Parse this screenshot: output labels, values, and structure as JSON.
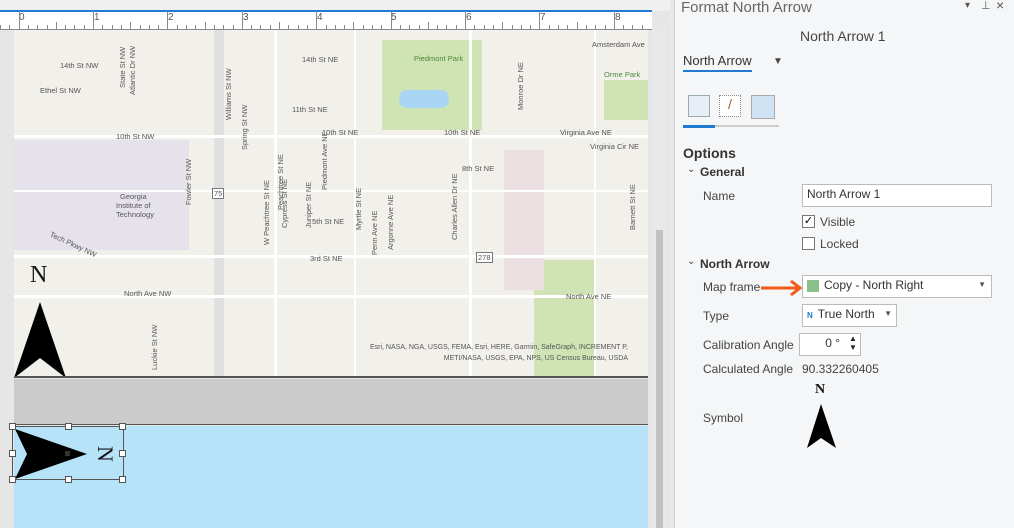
{
  "ruler": {
    "labels": [
      "0",
      "1",
      "2",
      "3",
      "4",
      "5",
      "6",
      "7",
      "8"
    ]
  },
  "map": {
    "labels": [
      "Amsterdam Ave",
      "14th St NW",
      "14th St NE",
      "Piedmont Park",
      "Ethel St NW",
      "Orme Park",
      "11th St NE",
      "10th St NW",
      "10th St NE",
      "10th St NE",
      "Virginia Ave NE",
      "Virginia Cir NE",
      "8th St NE",
      "5th St NE",
      "Tech Pkwy NW",
      "3rd St NE",
      "North Ave NW",
      "North Ave NE",
      "Georgia",
      "Institute of",
      "Technology",
      "75",
      "278"
    ],
    "vlabels": [
      "State St NW",
      "Atlantic Dr NW",
      "Williams St NW",
      "Spring St NW",
      "Fowler St NW",
      "W Peachtree St NE",
      "Peachtree St NE",
      "Cypress St NE",
      "Juniper St NE",
      "Piedmont Ave NE",
      "Myrtle St NE",
      "Penn Ave NE",
      "Argonne Ave NE",
      "Charles Allen Dr NE",
      "Monroe Dr NE",
      "Barnett St NE",
      "Luckie St NW"
    ],
    "attribution_line1": "Esri, NASA, NGA, USGS, FEMA, Esri, HERE, Garmin, SafeGraph, INCREMENT P,",
    "attribution_line2": "METI/NASA, USGS, EPA, NPS, US Census Bureau, USDA",
    "north_arrow_letter": "N"
  },
  "selected_arrow": {
    "letter": "N"
  },
  "panel": {
    "title": "Format North Arrow",
    "element_name": "North Arrow 1",
    "element_selector": "North Arrow",
    "section_options": "Options",
    "group_general": "General",
    "name_label": "Name",
    "name_value": "North Arrow 1",
    "visible_label": "Visible",
    "visible_checked": true,
    "locked_label": "Locked",
    "locked_checked": false,
    "group_north_arrow": "North Arrow",
    "map_frame_label": "Map frame",
    "map_frame_value": "Copy - North Right",
    "type_label": "Type",
    "type_value": "True North",
    "type_icon_letter": "N",
    "calibration_label": "Calibration Angle",
    "calibration_value": "0 °",
    "calculated_label": "Calculated Angle",
    "calculated_value": "90.332260405",
    "symbol_label": "Symbol",
    "symbol_letter": "N"
  },
  "colors": {
    "accent": "#1f7ad1",
    "annotation_arrow": "#f05a14",
    "water": "#b6e3f8"
  }
}
